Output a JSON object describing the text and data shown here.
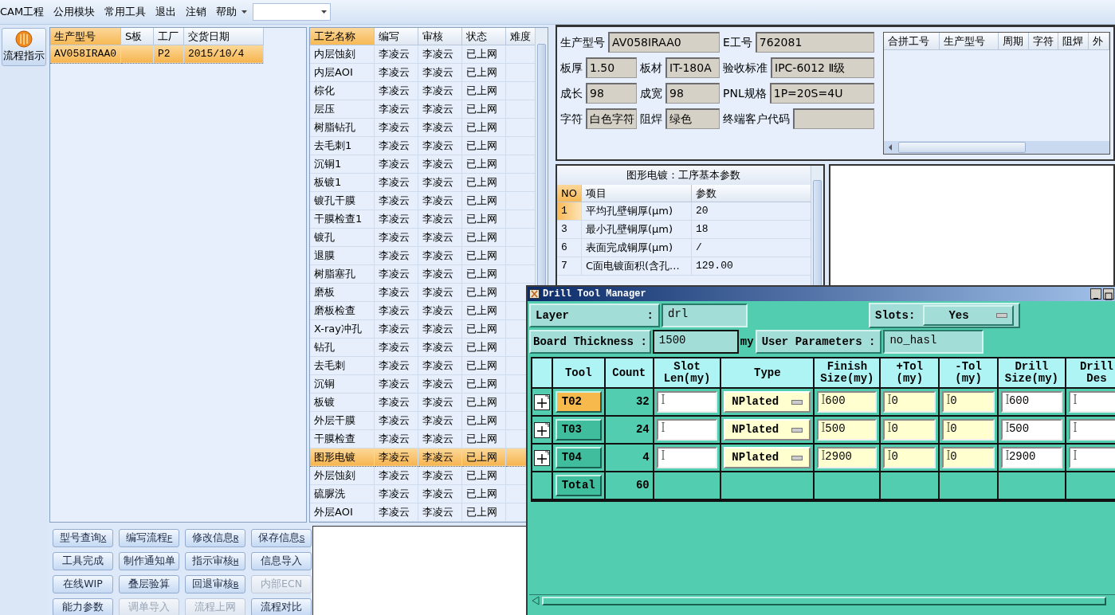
{
  "menu": [
    {
      "label": "CAM工程"
    },
    {
      "label": "公用模块"
    },
    {
      "label": "常用工具"
    },
    {
      "label": "退出"
    },
    {
      "label": "注销"
    },
    {
      "label": "帮助"
    }
  ],
  "sidebar": {
    "button": "流程指示"
  },
  "orders": {
    "columns": [
      {
        "label": "生产型号",
        "highlighted": true
      },
      {
        "label": "S板",
        "highlighted": false
      },
      {
        "label": "工厂",
        "highlighted": false
      },
      {
        "label": "交货日期",
        "highlighted": false
      }
    ],
    "rows": [
      {
        "cells": [
          "AV058IRAA0",
          "",
          "P2",
          "2015/10/4"
        ],
        "selected": true
      }
    ]
  },
  "processes": {
    "columns": [
      {
        "label": "工艺名称",
        "highlighted": true
      },
      {
        "label": "编写",
        "highlighted": false
      },
      {
        "label": "审核",
        "highlighted": false
      },
      {
        "label": "状态",
        "highlighted": false
      },
      {
        "label": "难度",
        "highlighted": false
      }
    ],
    "rows": [
      {
        "cells": [
          "内层蚀刻",
          "李凌云",
          "李凌云",
          "已上网"
        ],
        "selected": false
      },
      {
        "cells": [
          "内层AOI",
          "李凌云",
          "李凌云",
          "已上网"
        ],
        "selected": false
      },
      {
        "cells": [
          "棕化",
          "李凌云",
          "李凌云",
          "已上网"
        ],
        "selected": false
      },
      {
        "cells": [
          "层压",
          "李凌云",
          "李凌云",
          "已上网"
        ],
        "selected": false
      },
      {
        "cells": [
          "树脂钻孔",
          "李凌云",
          "李凌云",
          "已上网"
        ],
        "selected": false
      },
      {
        "cells": [
          "去毛刺1",
          "李凌云",
          "李凌云",
          "已上网"
        ],
        "selected": false
      },
      {
        "cells": [
          "沉铜1",
          "李凌云",
          "李凌云",
          "已上网"
        ],
        "selected": false
      },
      {
        "cells": [
          "板镀1",
          "李凌云",
          "李凌云",
          "已上网"
        ],
        "selected": false
      },
      {
        "cells": [
          "镀孔干膜",
          "李凌云",
          "李凌云",
          "已上网"
        ],
        "selected": false
      },
      {
        "cells": [
          "干膜检查1",
          "李凌云",
          "李凌云",
          "已上网"
        ],
        "selected": false
      },
      {
        "cells": [
          "镀孔",
          "李凌云",
          "李凌云",
          "已上网"
        ],
        "selected": false
      },
      {
        "cells": [
          "退膜",
          "李凌云",
          "李凌云",
          "已上网"
        ],
        "selected": false
      },
      {
        "cells": [
          "树脂塞孔",
          "李凌云",
          "李凌云",
          "已上网"
        ],
        "selected": false
      },
      {
        "cells": [
          "磨板",
          "李凌云",
          "李凌云",
          "已上网"
        ],
        "selected": false
      },
      {
        "cells": [
          "磨板检查",
          "李凌云",
          "李凌云",
          "已上网"
        ],
        "selected": false
      },
      {
        "cells": [
          "X-ray冲孔",
          "李凌云",
          "李凌云",
          "已上网"
        ],
        "selected": false
      },
      {
        "cells": [
          "钻孔",
          "李凌云",
          "李凌云",
          "已上网"
        ],
        "selected": false
      },
      {
        "cells": [
          "去毛刺",
          "李凌云",
          "李凌云",
          "已上网"
        ],
        "selected": false
      },
      {
        "cells": [
          "沉铜",
          "李凌云",
          "李凌云",
          "已上网"
        ],
        "selected": false
      },
      {
        "cells": [
          "板镀",
          "李凌云",
          "李凌云",
          "已上网"
        ],
        "selected": false
      },
      {
        "cells": [
          "外层干膜",
          "李凌云",
          "李凌云",
          "已上网"
        ],
        "selected": false
      },
      {
        "cells": [
          "干膜检查",
          "李凌云",
          "李凌云",
          "已上网"
        ],
        "selected": false
      },
      {
        "cells": [
          "图形电镀",
          "李凌云",
          "李凌云",
          "已上网"
        ],
        "selected": true
      },
      {
        "cells": [
          "外层蚀刻",
          "李凌云",
          "李凌云",
          "已上网"
        ],
        "selected": false
      },
      {
        "cells": [
          "硫脲洗",
          "李凌云",
          "李凌云",
          "已上网"
        ],
        "selected": false
      },
      {
        "cells": [
          "外层AOI",
          "李凌云",
          "李凌云",
          "已上网"
        ],
        "selected": false
      }
    ]
  },
  "info": {
    "rows": [
      [
        {
          "label": "生产型号",
          "value": "AV058IRAA0"
        },
        null,
        {
          "label": "E工号",
          "value": "762081"
        }
      ],
      [
        {
          "label": "板厚",
          "value": "1.50"
        },
        {
          "label": "板材",
          "value": "IT-180A"
        },
        {
          "label": "验收标准",
          "value": "IPC-6012 Ⅱ级"
        }
      ],
      [
        {
          "label": "成长",
          "value": "98"
        },
        {
          "label": "成宽",
          "value": "98"
        },
        {
          "label": "PNL规格",
          "value": "1P=20S=4U"
        }
      ],
      [
        {
          "label": "字符",
          "value": "白色字符"
        },
        {
          "label": "阻焊",
          "value": "绿色"
        },
        {
          "label": "终端客户代码"
        }
      ]
    ]
  },
  "merge_table": {
    "columns": [
      "合拼工号",
      "生产型号",
      "周期",
      "字符",
      "阻焊",
      "外"
    ]
  },
  "params": {
    "title": "图形电镀：工序基本参数",
    "columns": [
      "NO",
      "项目",
      "参数"
    ],
    "rows": [
      {
        "no": "1",
        "item": "平均孔壁铜厚(μm)",
        "value": "20",
        "selected": true
      },
      {
        "no": "3",
        "item": "最小孔壁铜厚(μm)",
        "value": "18",
        "selected": false
      },
      {
        "no": "6",
        "item": "表面完成铜厚(μm)",
        "value": "/",
        "selected": false
      },
      {
        "no": "7",
        "item": "C面电镀面积(含孔...",
        "value": "129.00",
        "selected": false
      }
    ]
  },
  "buttons": [
    {
      "label": "型号查询",
      "hotkey": "X",
      "disabled": false
    },
    {
      "label": "编写流程",
      "hotkey": "F",
      "disabled": false
    },
    {
      "label": "修改信息",
      "hotkey": "R",
      "disabled": false
    },
    {
      "label": "保存信息",
      "hotkey": "S",
      "disabled": false
    },
    {
      "label": "工具完成",
      "disabled": false
    },
    {
      "label": "制作通知单",
      "disabled": false
    },
    {
      "label": "指示审核",
      "hotkey": "H",
      "disabled": false
    },
    {
      "label": "信息导入",
      "disabled": false
    },
    {
      "label": "在线WIP",
      "disabled": false
    },
    {
      "label": "叠层验算",
      "disabled": false
    },
    {
      "label": "回退审核",
      "hotkey": "B",
      "disabled": false
    },
    {
      "label": "内部ECN",
      "disabled": true
    },
    {
      "label": "能力参数",
      "disabled": false
    },
    {
      "label": "调单导入",
      "disabled": true
    },
    {
      "label": "流程上网",
      "disabled": true
    },
    {
      "label": "流程对比",
      "disabled": false
    }
  ],
  "drill_window": {
    "title": "Drill Tool Manager",
    "layer": {
      "label": "Layer",
      "sep": ":",
      "value": "drl"
    },
    "slots": {
      "label": "Slots:",
      "value": "Yes"
    },
    "thickness": {
      "label": "Board Thickness :",
      "value": "1500",
      "unit": "my"
    },
    "user_params": {
      "label": "User Parameters :",
      "value": "no_hasl"
    },
    "columns": [
      "Tool",
      "Count",
      "Slot\nLen(my)",
      "Type",
      "Finish\nSize(my)",
      "+Tol\n(my)",
      "-Tol\n(my)",
      "Drill\nSize(my)",
      "Drill\nDes"
    ],
    "tools": [
      {
        "tool": "T02",
        "count": "32",
        "type": "NPlated",
        "finish": "600",
        "plus_tol": "0",
        "minus_tol": "0",
        "drill_size": "600",
        "selected": true
      },
      {
        "tool": "T03",
        "count": "24",
        "type": "NPlated",
        "finish": "500",
        "plus_tol": "0",
        "minus_tol": "0",
        "drill_size": "500",
        "selected": false
      },
      {
        "tool": "T04",
        "count": "4",
        "type": "NPlated",
        "finish": "2900",
        "plus_tol": "0",
        "minus_tol": "0",
        "drill_size": "2900",
        "selected": false
      }
    ],
    "total": {
      "label": "Total",
      "count": "60"
    }
  }
}
